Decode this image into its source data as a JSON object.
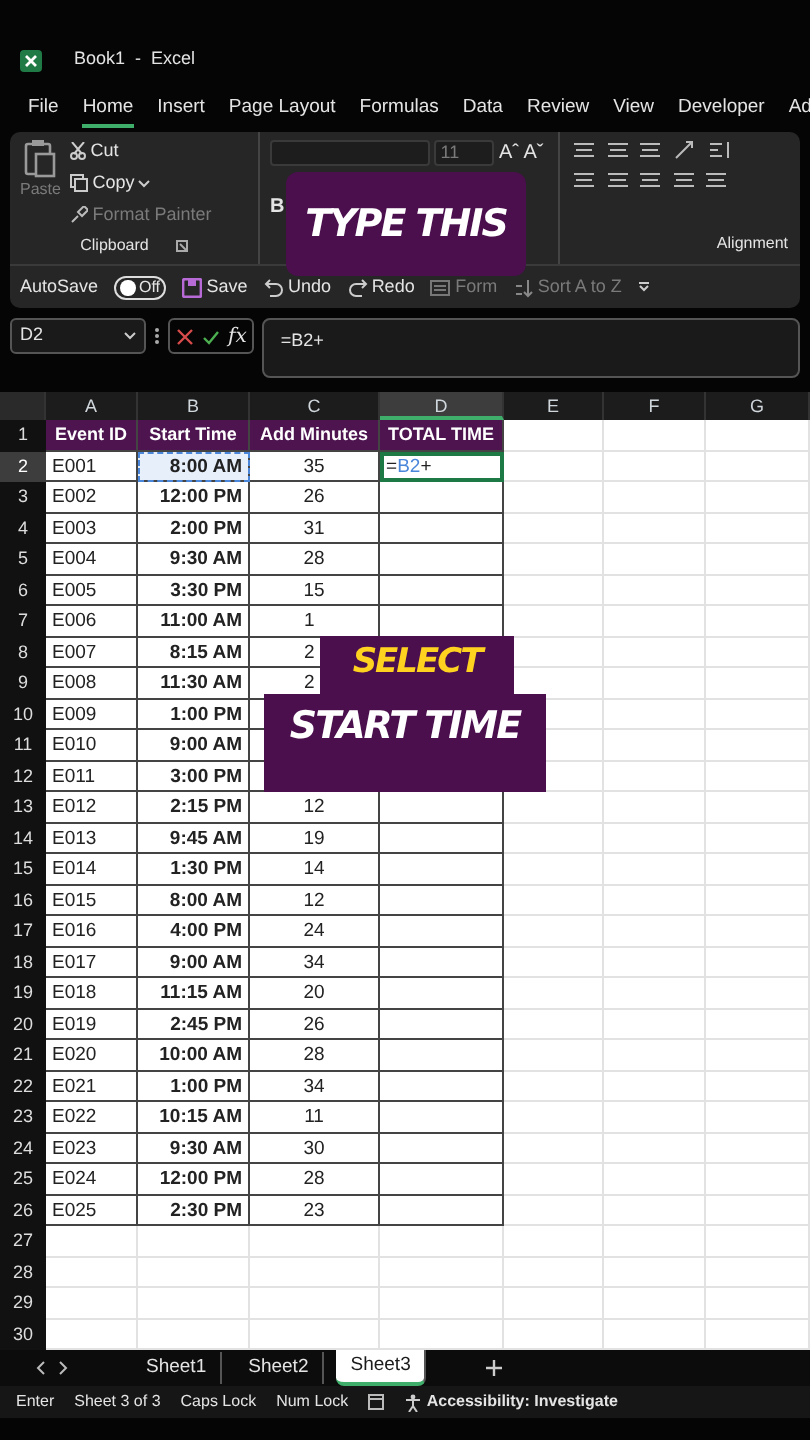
{
  "window": {
    "title": "Book1  -  Excel"
  },
  "menu_tabs": [
    {
      "label": "File",
      "selected": false
    },
    {
      "label": "Home",
      "selected": true
    },
    {
      "label": "Insert",
      "selected": false
    },
    {
      "label": "Page Layout",
      "selected": false
    },
    {
      "label": "Formulas",
      "selected": false
    },
    {
      "label": "Data",
      "selected": false
    },
    {
      "label": "Review",
      "selected": false
    },
    {
      "label": "View",
      "selected": false
    },
    {
      "label": "Developer",
      "selected": false
    },
    {
      "label": "Ad",
      "selected": false
    }
  ],
  "ribbon": {
    "clipboard": {
      "paste": "Paste",
      "cut": "Cut",
      "copy": "Copy",
      "format_painter": "Format Painter",
      "format_painter_disabled": true,
      "label": "Clipboard"
    },
    "font": {
      "size": "11",
      "size_buttons": [
        "Aˆ",
        "Aˇ"
      ],
      "bold": "B"
    },
    "alignment": {
      "label": "Alignment"
    }
  },
  "quick_access": {
    "autosave": {
      "label": "AutoSave",
      "on": false,
      "state_text": "Off"
    },
    "items": [
      {
        "kind": "save",
        "label": "Save",
        "disabled": false
      },
      {
        "kind": "undo",
        "label": "Undo",
        "disabled": false
      },
      {
        "kind": "redo",
        "label": "Redo",
        "disabled": false
      },
      {
        "kind": "form",
        "label": "Form",
        "disabled": true
      },
      {
        "kind": "sort",
        "label": "Sort A to Z",
        "disabled": true
      }
    ]
  },
  "formula_bar": {
    "name_box": "D2",
    "function_label": "fx",
    "formula": "=B2+"
  },
  "sheet": {
    "columns": [
      {
        "label": "A",
        "selected": false
      },
      {
        "label": "B",
        "selected": false
      },
      {
        "label": "C",
        "selected": false
      },
      {
        "label": "D",
        "selected": true
      },
      {
        "label": "E",
        "selected": false
      },
      {
        "label": "F",
        "selected": false
      },
      {
        "label": "G",
        "selected": false
      }
    ],
    "rows": [
      {
        "number": "1",
        "selected": false,
        "kind": "header",
        "cells": [
          "Event ID",
          "Start Time",
          "Add Minutes",
          "TOTAL TIME"
        ]
      },
      {
        "number": "2",
        "selected": true,
        "kind": "data",
        "cells": [
          "E001",
          "8:00 AM",
          "35",
          {
            "kind": "formula",
            "parts": [
              {
                "text": "=",
                "ref": false
              },
              {
                "text": "B2",
                "ref": true
              },
              {
                "text": "+",
                "ref": false
              }
            ]
          }
        ]
      },
      {
        "number": "3",
        "selected": false,
        "kind": "data",
        "cells": [
          "E002",
          "12:00 PM",
          "26",
          null
        ]
      },
      {
        "number": "4",
        "selected": false,
        "kind": "data",
        "cells": [
          "E003",
          "2:00 PM",
          "31",
          null
        ]
      },
      {
        "number": "5",
        "selected": false,
        "kind": "data",
        "cells": [
          "E004",
          "9:30 AM",
          "28",
          null
        ]
      },
      {
        "number": "6",
        "selected": false,
        "kind": "data",
        "cells": [
          "E005",
          "3:30 PM",
          "15",
          null
        ]
      },
      {
        "number": "7",
        "selected": false,
        "kind": "data",
        "cells": [
          "E006",
          "11:00 AM",
          {
            "kind": "clipped",
            "text": "1"
          },
          null
        ]
      },
      {
        "number": "8",
        "selected": false,
        "kind": "data",
        "cells": [
          "E007",
          "8:15 AM",
          {
            "kind": "clipped",
            "text": "2"
          },
          null
        ]
      },
      {
        "number": "9",
        "selected": false,
        "kind": "data",
        "cells": [
          "E008",
          "11:30 AM",
          {
            "kind": "clipped",
            "text": "2"
          },
          null
        ]
      },
      {
        "number": "10",
        "selected": false,
        "kind": "data",
        "cells": [
          "E009",
          "1:00 PM",
          null,
          null
        ]
      },
      {
        "number": "11",
        "selected": false,
        "kind": "data",
        "cells": [
          "E010",
          "9:00 AM",
          null,
          null
        ]
      },
      {
        "number": "12",
        "selected": false,
        "kind": "data",
        "cells": [
          "E011",
          "3:00 PM",
          null,
          null
        ]
      },
      {
        "number": "13",
        "selected": false,
        "kind": "data",
        "cells": [
          "E012",
          "2:15 PM",
          "12",
          null
        ]
      },
      {
        "number": "14",
        "selected": false,
        "kind": "data",
        "cells": [
          "E013",
          "9:45 AM",
          "19",
          null
        ]
      },
      {
        "number": "15",
        "selected": false,
        "kind": "data",
        "cells": [
          "E014",
          "1:30 PM",
          "14",
          null
        ]
      },
      {
        "number": "16",
        "selected": false,
        "kind": "data",
        "cells": [
          "E015",
          "8:00 AM",
          "12",
          null
        ]
      },
      {
        "number": "17",
        "selected": false,
        "kind": "data",
        "cells": [
          "E016",
          "4:00 PM",
          "24",
          null
        ]
      },
      {
        "number": "18",
        "selected": false,
        "kind": "data",
        "cells": [
          "E017",
          "9:00 AM",
          "34",
          null
        ]
      },
      {
        "number": "19",
        "selected": false,
        "kind": "data",
        "cells": [
          "E018",
          "11:15 AM",
          "20",
          null
        ]
      },
      {
        "number": "20",
        "selected": false,
        "kind": "data",
        "cells": [
          "E019",
          "2:45 PM",
          "26",
          null
        ]
      },
      {
        "number": "21",
        "selected": false,
        "kind": "data",
        "cells": [
          "E020",
          "10:00 AM",
          "28",
          null
        ]
      },
      {
        "number": "22",
        "selected": false,
        "kind": "data",
        "cells": [
          "E021",
          "1:00 PM",
          "34",
          null
        ]
      },
      {
        "number": "23",
        "selected": false,
        "kind": "data",
        "cells": [
          "E022",
          "10:15 AM",
          "11",
          null
        ]
      },
      {
        "number": "24",
        "selected": false,
        "kind": "data",
        "cells": [
          "E023",
          "9:30 AM",
          "30",
          null
        ]
      },
      {
        "number": "25",
        "selected": false,
        "kind": "data",
        "cells": [
          "E024",
          "12:00 PM",
          "28",
          null
        ]
      },
      {
        "number": "26",
        "selected": false,
        "kind": "data",
        "cells": [
          "E025",
          "2:30 PM",
          "23",
          null
        ]
      },
      {
        "number": "27",
        "selected": false,
        "kind": "empty"
      },
      {
        "number": "28",
        "selected": false,
        "kind": "empty"
      },
      {
        "number": "29",
        "selected": false,
        "kind": "empty"
      },
      {
        "number": "30",
        "selected": false,
        "kind": "empty"
      }
    ]
  },
  "sheet_tabs": [
    {
      "label": "Sheet1",
      "selected": false
    },
    {
      "label": "Sheet2",
      "selected": false
    },
    {
      "label": "Sheet3",
      "selected": true
    }
  ],
  "status_bar": {
    "mode": "Enter",
    "sheet_position": "Sheet 3 of 3",
    "caps_lock": "Caps Lock",
    "num_lock": "Num Lock",
    "accessibility": "Accessibility: Investigate"
  },
  "overlays": [
    {
      "kind": "type",
      "lines": [
        {
          "text": "TYPE THIS",
          "highlight": false
        }
      ]
    },
    {
      "kind": "select",
      "lines": [
        {
          "text": "SELECT",
          "highlight": true
        },
        {
          "text": "START TIME",
          "highlight": false
        }
      ]
    }
  ]
}
